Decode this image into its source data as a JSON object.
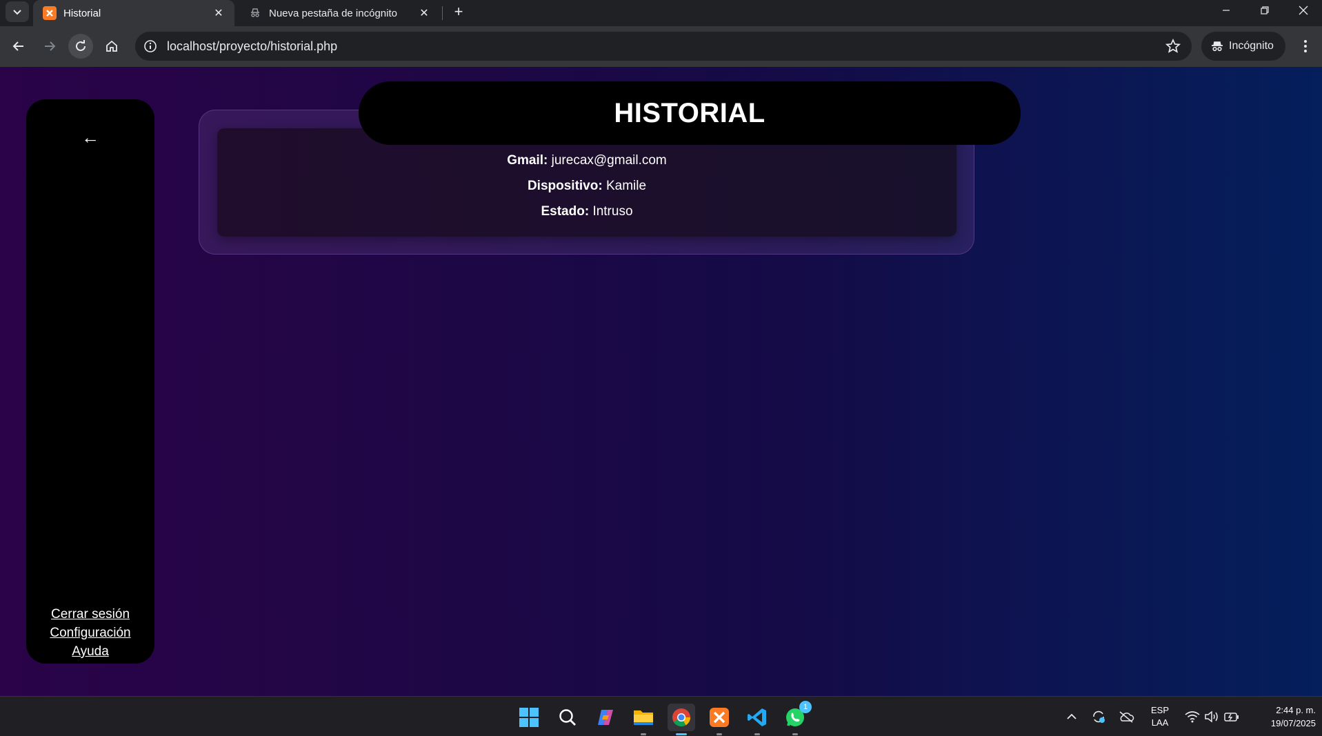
{
  "browser": {
    "tabs": [
      {
        "title": "Historial",
        "active": true
      },
      {
        "title": "Nueva pestaña de incógnito",
        "active": false
      }
    ],
    "url": "localhost/proyecto/historial.php",
    "incognito_label": "Incógnito"
  },
  "page": {
    "title": "HISTORIAL",
    "sidebar": {
      "back_symbol": "←",
      "links": [
        "Cerrar sesión",
        "Configuración",
        "Ayuda"
      ]
    },
    "record": {
      "gmail_label": "Gmail:",
      "gmail_value": "jurecax@gmail.com",
      "device_label": "Dispositivo:",
      "device_value": "Kamile",
      "status_label": "Estado:",
      "status_value": "Intruso"
    }
  },
  "taskbar": {
    "apps": [
      "windows-start",
      "search",
      "copilot",
      "file-explorer",
      "chrome",
      "xampp",
      "vscode",
      "whatsapp"
    ],
    "whatsapp_badge": "1",
    "language": {
      "line1": "ESP",
      "line2": "LAA"
    },
    "time": "2:44 p. m.",
    "date": "19/07/2025"
  },
  "colors": {
    "xampp": "#fb7a24",
    "accent_blue": "#4cc2ff",
    "vscode": "#23a9f2",
    "whatsapp": "#25d366"
  }
}
